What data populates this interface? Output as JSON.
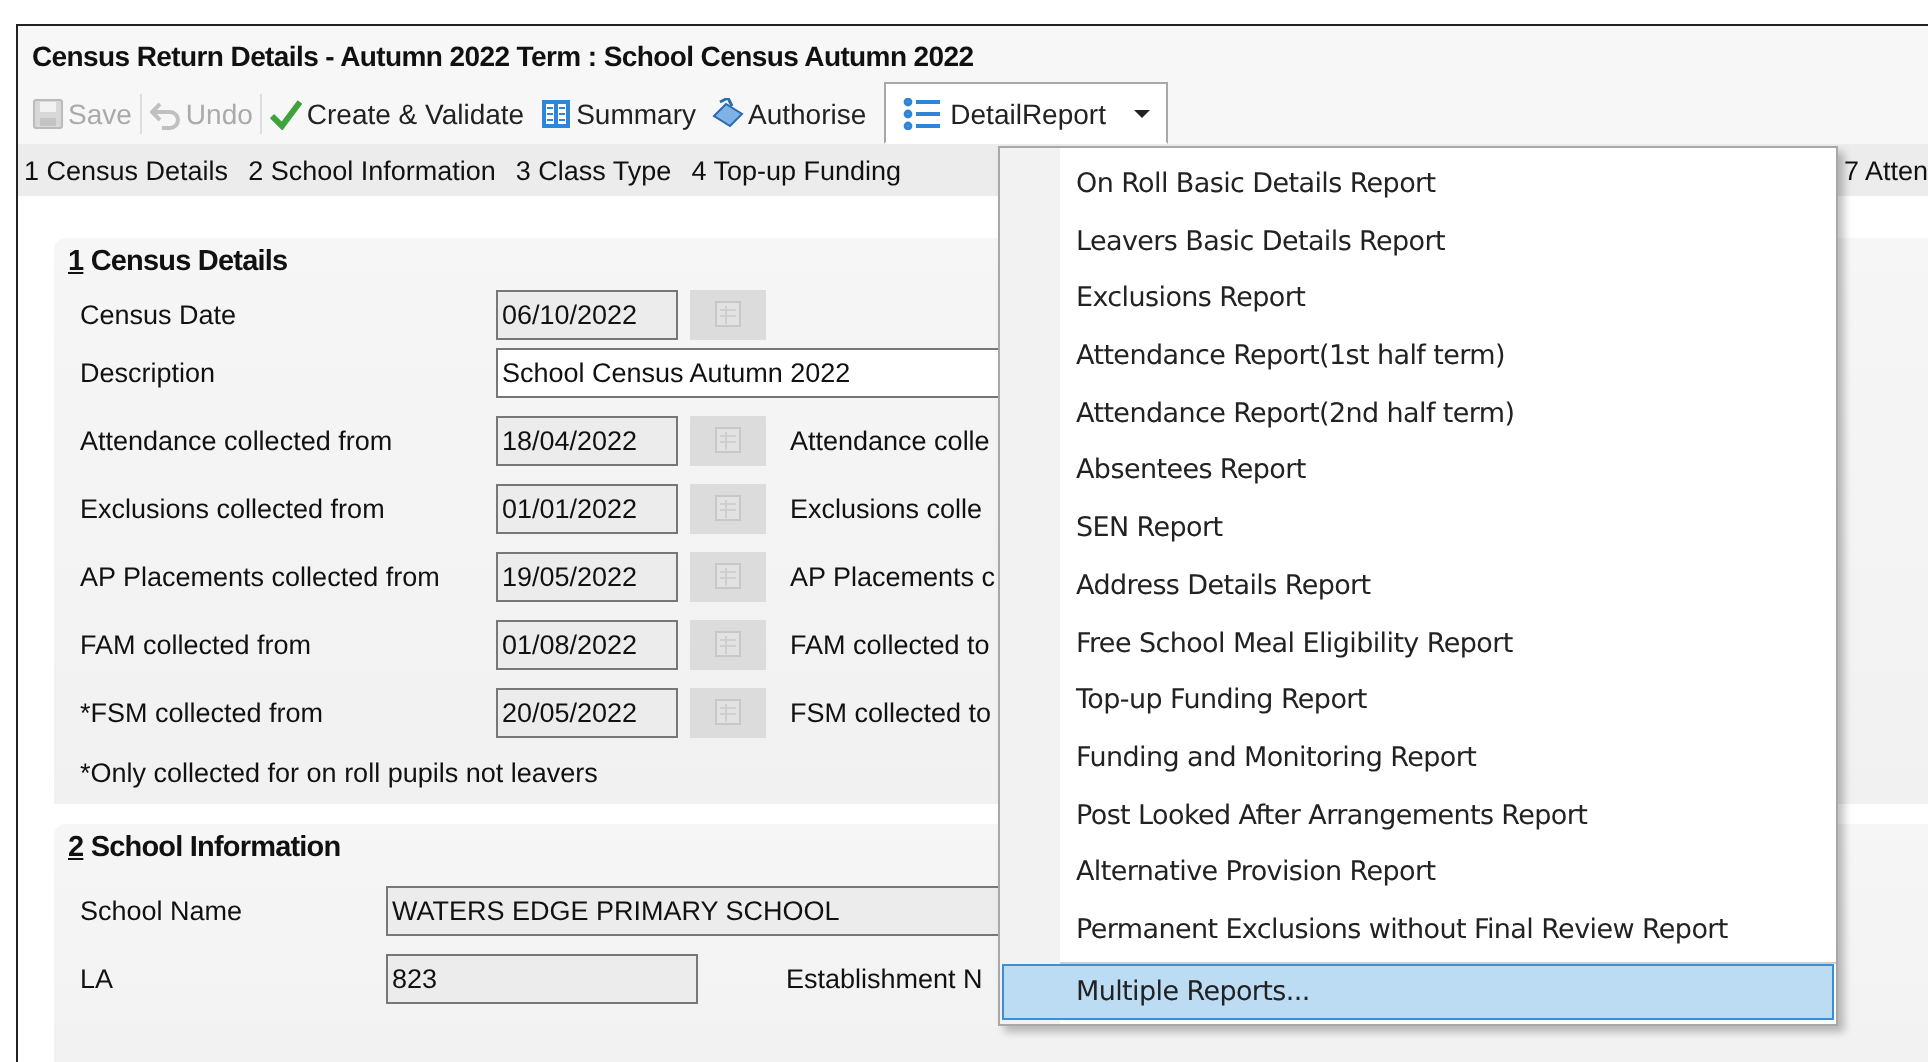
{
  "window": {
    "title": "Census Return Details - Autumn 2022 Term : School Census Autumn 2022"
  },
  "toolbar": [
    {
      "label": "Save",
      "kind": "save",
      "disabled": true
    },
    {
      "label": "Undo",
      "kind": "undo",
      "disabled": true
    },
    {
      "label": "Create & Validate",
      "kind": "check",
      "disabled": false
    },
    {
      "label": "Summary",
      "kind": "summary",
      "disabled": false
    },
    {
      "label": "Authorise",
      "kind": "authorise",
      "disabled": false
    }
  ],
  "report_button": {
    "label": "DetailReport",
    "expanded": true
  },
  "tabs": [
    {
      "label": "1 Census Details"
    },
    {
      "label": "2 School Information"
    },
    {
      "label": "3 Class Type"
    },
    {
      "label": "4 Top-up Funding"
    },
    {
      "label": "7 Atten"
    }
  ],
  "census_details": {
    "number": "1",
    "title": "Census Details",
    "rows": [
      {
        "label": "Census Date",
        "value": "06/10/2022",
        "kind": "date"
      },
      {
        "label": "Description",
        "value": "School Census Autumn 2022",
        "kind": "text"
      },
      {
        "label": "Attendance collected from",
        "value": "18/04/2022",
        "kind": "date",
        "to_label": "Attendance colle"
      },
      {
        "label": "Exclusions collected from",
        "value": "01/01/2022",
        "kind": "date",
        "to_label": "Exclusions colle"
      },
      {
        "label": "AP Placements collected from",
        "value": "19/05/2022",
        "kind": "date",
        "to_label": "AP Placements c"
      },
      {
        "label": "FAM collected from",
        "value": "01/08/2022",
        "kind": "date",
        "to_label": "FAM collected to"
      },
      {
        "label": "*FSM collected from",
        "value": "20/05/2022",
        "kind": "date",
        "to_label": "FSM collected to"
      }
    ],
    "note": "*Only collected for on roll pupils not leavers"
  },
  "school_information": {
    "number": "2",
    "title": "School Information",
    "rows": [
      {
        "label": "School Name",
        "value": "WATERS EDGE PRIMARY SCHOOL",
        "kind": "wide"
      },
      {
        "label": "LA",
        "value": "823",
        "kind": "short",
        "to_label": "Establishment N"
      }
    ]
  },
  "report_menu": [
    {
      "label": "On Roll Basic Details Report",
      "selected": false
    },
    {
      "label": "Leavers Basic Details Report",
      "selected": false
    },
    {
      "label": "Exclusions Report",
      "selected": false
    },
    {
      "label": "Attendance Report(1st half term)",
      "selected": false
    },
    {
      "label": "Attendance Report(2nd half term)",
      "selected": false
    },
    {
      "label": "Absentees Report",
      "selected": false
    },
    {
      "label": "SEN Report",
      "selected": false
    },
    {
      "label": "Address Details Report",
      "selected": false
    },
    {
      "label": "Free School Meal Eligibility Report",
      "selected": false
    },
    {
      "label": "Top-up Funding Report",
      "selected": false
    },
    {
      "label": "Funding and Monitoring Report",
      "selected": false
    },
    {
      "label": "Post Looked After Arrangements Report",
      "selected": false
    },
    {
      "label": "Alternative Provision Report",
      "selected": false
    },
    {
      "label": "Permanent Exclusions without Final Review Report",
      "selected": false
    },
    {
      "label": "Multiple Reports...",
      "selected": true,
      "separated": true
    }
  ]
}
